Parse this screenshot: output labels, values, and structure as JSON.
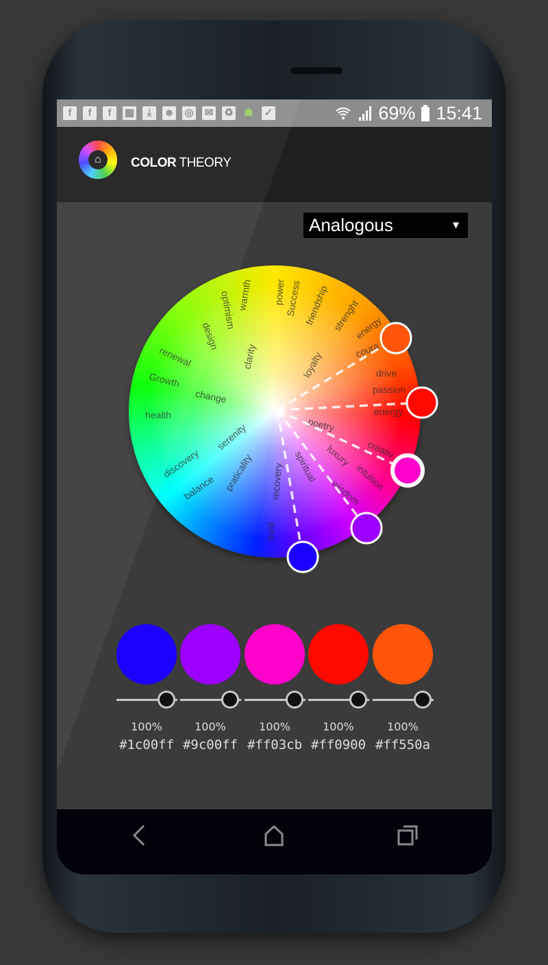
{
  "status_bar": {
    "left_icons": [
      "facebook-icon",
      "facebook-icon",
      "facebook-icon",
      "calendar-icon",
      "download-icon",
      "fitness-icon",
      "sync-icon",
      "mail-icon",
      "battery-recycle-icon",
      "android-icon",
      "clipboard-check-icon"
    ],
    "wifi": "wifi-icon",
    "signal": "signal-icon",
    "battery_percent": "69%",
    "time": "15:41"
  },
  "app_bar": {
    "title_bold": "COLOR",
    "title_rest": " THEORY",
    "logo_icon": "home-icon"
  },
  "scheme_select": {
    "selected": "Analogous"
  },
  "wheel": {
    "words": [
      "warmth",
      "optimism",
      "design",
      "power",
      "Success",
      "friendship",
      "strenght",
      "energy",
      "coura",
      "drive",
      "passion",
      "energy",
      "loyalty",
      "clarity",
      "renewal",
      "Growth",
      "change",
      "health",
      "serenity",
      "discovery",
      "balance",
      "praticality",
      "recovery",
      "trust",
      "spiritual",
      "poetry",
      "luxury",
      "creativ",
      "intuition",
      "wisdom"
    ],
    "handles": [
      {
        "color": "#ff550a",
        "selected": false
      },
      {
        "color": "#ff0900",
        "selected": false
      },
      {
        "color": "#ff03cb",
        "selected": true
      },
      {
        "color": "#9c00ff",
        "selected": false
      },
      {
        "color": "#1c00ff",
        "selected": false
      }
    ]
  },
  "swatches": [
    {
      "color": "#1c00ff",
      "hex": "#1c00ff",
      "opacity": "100%",
      "opacity_value": 100
    },
    {
      "color": "#9c00ff",
      "hex": "#9c00ff",
      "opacity": "100%",
      "opacity_value": 100
    },
    {
      "color": "#ff03cb",
      "hex": "#ff03cb",
      "opacity": "100%",
      "opacity_value": 100
    },
    {
      "color": "#ff0900",
      "hex": "#ff0900",
      "opacity": "100%",
      "opacity_value": 100
    },
    {
      "color": "#ff550a",
      "hex": "#ff550a",
      "opacity": "100%",
      "opacity_value": 100
    }
  ],
  "nav": {
    "back": "back-icon",
    "home": "home-icon",
    "recents": "recents-icon"
  }
}
